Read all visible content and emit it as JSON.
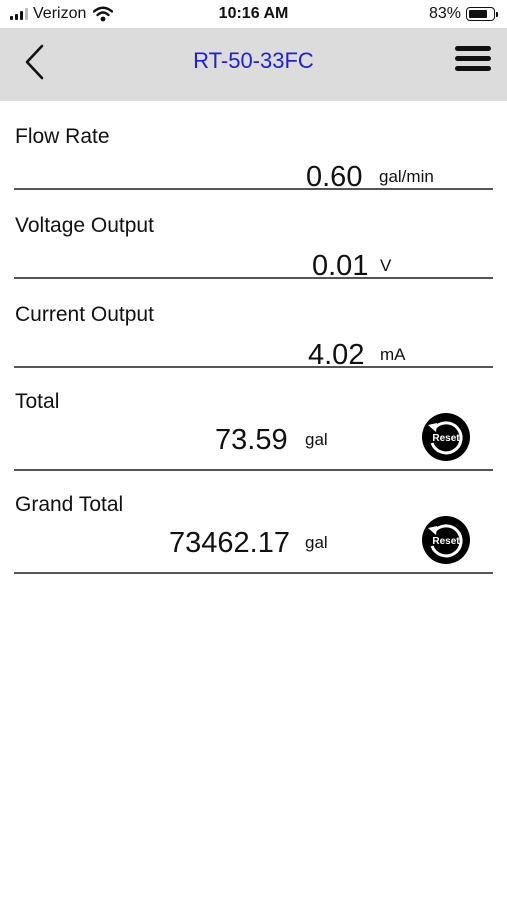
{
  "status_bar": {
    "carrier": "Verizon",
    "time": "10:16 AM",
    "battery_text": "83%",
    "battery_level": 0.83
  },
  "nav": {
    "title": "RT-50-33FC",
    "title_color": "#2121c8",
    "back_icon": "chevron-left-icon",
    "menu_icon": "hamburger-menu-icon"
  },
  "readings": [
    {
      "label": "Flow Rate",
      "value": "0.60",
      "unit": "gal/min"
    },
    {
      "label": "Voltage Output",
      "value": "0.01",
      "unit": "V"
    },
    {
      "label": "Current Output",
      "value": "4.02",
      "unit": "mA"
    }
  ],
  "totals": [
    {
      "label": "Total",
      "value": "73.59",
      "unit": "gal",
      "reset_label": "Reset"
    },
    {
      "label": "Grand Total",
      "value": "73462.17",
      "unit": "gal",
      "reset_label": "Reset"
    }
  ]
}
